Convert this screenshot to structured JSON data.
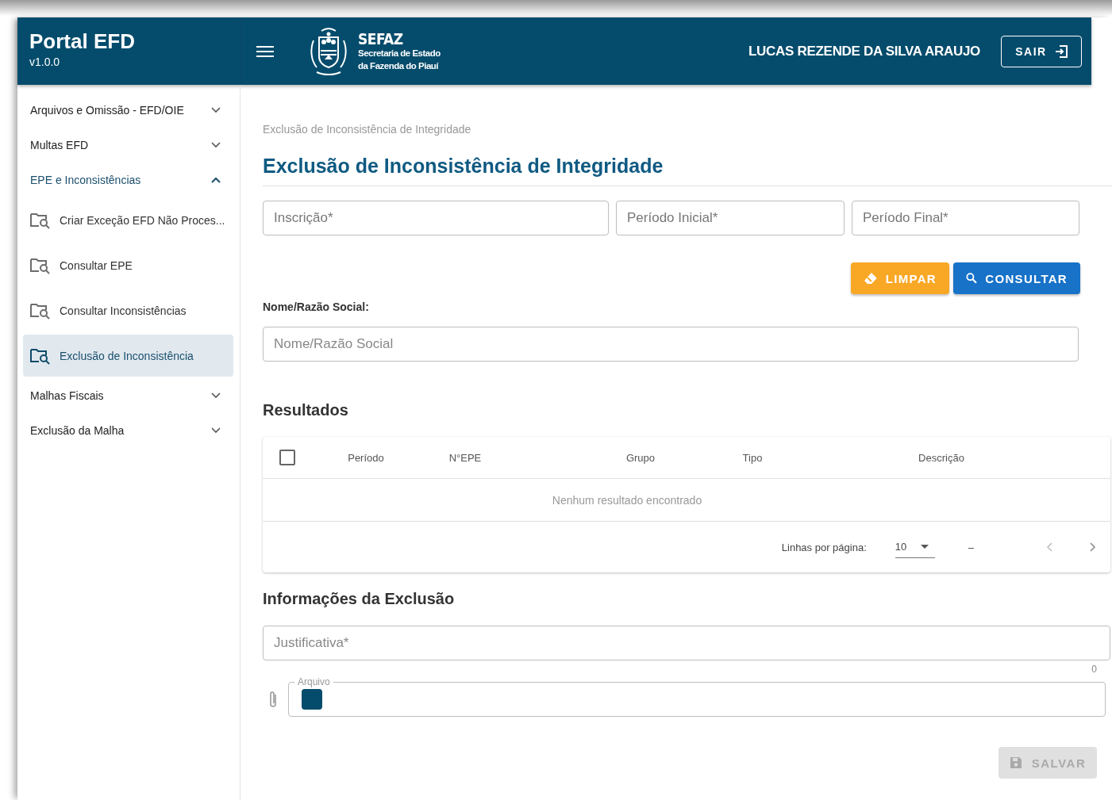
{
  "app": {
    "title": "Portal EFD",
    "version": "v1.0.0"
  },
  "header": {
    "logo": {
      "title": "SEFAZ",
      "line_1": "Secretaria de Estado",
      "line_2": "da Fazenda do Piauí"
    },
    "user_name": "LUCAS REZENDE DA SILVA ARAUJO",
    "logout_button": "SAIR"
  },
  "sidebar": {
    "items": [
      {
        "label": "Arquivos e Omissão - EFD/OIE",
        "expanded": false
      },
      {
        "label": "Multas EFD",
        "expanded": false
      },
      {
        "label": "EPE e Inconsistências",
        "expanded": true,
        "children": [
          {
            "label": "Criar Exceção EFD Não Proces...",
            "selected": false
          },
          {
            "label": "Consultar EPE",
            "selected": false
          },
          {
            "label": "Consultar Inconsistências",
            "selected": false
          },
          {
            "label": "Exclusão de Inconsistência",
            "selected": true
          }
        ]
      },
      {
        "label": "Malhas Fiscais",
        "expanded": false
      },
      {
        "label": "Exclusão da Malha",
        "expanded": false
      }
    ]
  },
  "breadcrumb": "Exclusão de Inconsistência de Integridade",
  "page_title": "Exclusão de Inconsistência de Integridade",
  "filters": [
    {
      "placeholder": "Inscrição*"
    },
    {
      "placeholder": "Período Inicial*"
    },
    {
      "placeholder": "Período Final*"
    }
  ],
  "buttons": [
    {
      "label": "LIMPAR",
      "kind": "clear"
    },
    {
      "label": "CONSULTAR",
      "kind": "search"
    }
  ],
  "name_field": {
    "label": "Nome/Razão Social:",
    "placeholder": "Nome/Razão Social"
  },
  "results": {
    "title": "Resultados",
    "select_all_checked": false,
    "columns": [
      "Período",
      "N°EPE",
      "Grupo",
      "Tipo",
      "Descrição"
    ],
    "empty_message": "Nenhum resultado encontrado",
    "pagination": {
      "label": "Linhas por página:",
      "rows_per_page": "10",
      "range": "–"
    }
  },
  "exclusion": {
    "title": "Informações da Exclusão",
    "justification": {
      "placeholder": "Justificativa*",
      "counter": "0"
    },
    "file": {
      "label": "Arquivo"
    },
    "save_button": {
      "label": "SALVAR",
      "disabled": true
    }
  }
}
